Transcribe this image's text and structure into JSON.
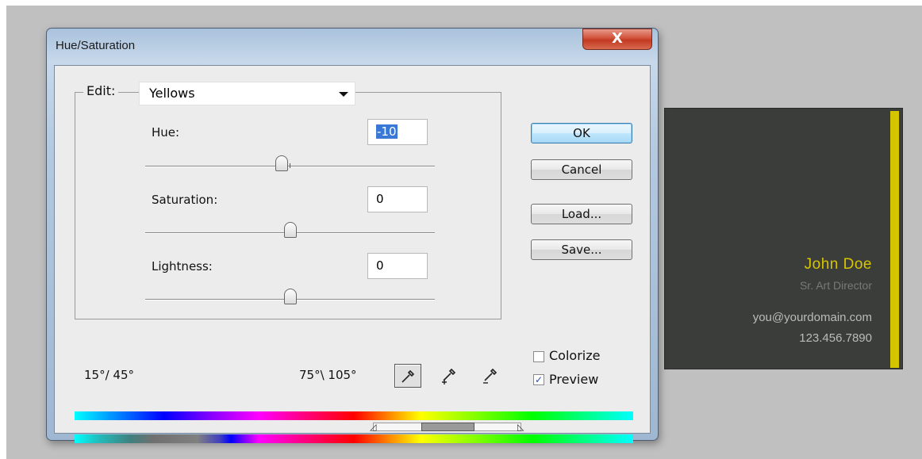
{
  "window": {
    "title": "Hue/Saturation",
    "close_glyph": "X"
  },
  "edit": {
    "label": "Edit:",
    "selected": "Yellows"
  },
  "hue": {
    "label": "Hue:",
    "value": "-10",
    "slider_fraction": 0.472
  },
  "saturation": {
    "label": "Saturation:",
    "value": "0",
    "slider_fraction": 0.5
  },
  "lightness": {
    "label": "Lightness:",
    "value": "0",
    "slider_fraction": 0.5
  },
  "buttons": {
    "ok": "OK",
    "cancel": "Cancel",
    "load": "Load...",
    "save": "Save..."
  },
  "options": {
    "colorize_label": "Colorize",
    "colorize_checked": false,
    "preview_label": "Preview",
    "preview_checked": true
  },
  "range": {
    "left": "15°/ 45°",
    "right": "75°\\ 105°"
  },
  "tools": [
    "eyedropper-icon",
    "eyedropper-plus-icon",
    "eyedropper-minus-icon"
  ],
  "card": {
    "name": "John Doe",
    "title": "Sr. Art Director",
    "email": "you@yourdomain.com",
    "phone": "123.456.7890",
    "accent": "#d5c500",
    "background": "#3a3d3a"
  }
}
